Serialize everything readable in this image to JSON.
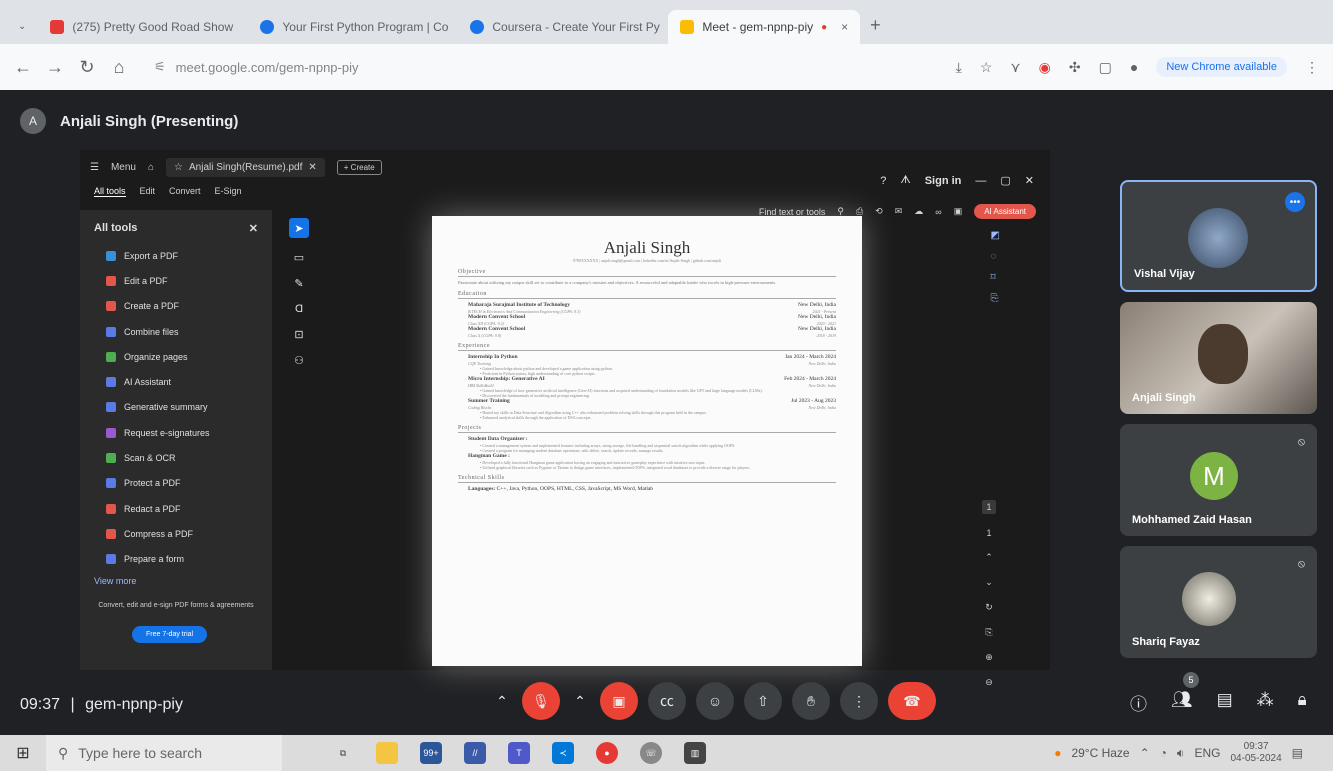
{
  "browser": {
    "tabs": [
      {
        "title": "(275) Pretty Good Road Show",
        "active": false,
        "favicon_color": "#e53935"
      },
      {
        "title": "Your First Python Program | Co",
        "active": false,
        "favicon_color": "#1a73e8"
      },
      {
        "title": "Coursera - Create Your First Py",
        "active": false,
        "favicon_color": "#1a73e8"
      },
      {
        "title": "Meet - gem-npnp-piy",
        "active": true,
        "favicon_color": "#fbbc04"
      }
    ],
    "tab_close": "×",
    "new_tab": "+",
    "url": "meet.google.com/gem-npnp-piy",
    "new_chrome_label": "New Chrome available"
  },
  "meet": {
    "presenter_initial": "A",
    "presenter_label": "Anjali Singh (Presenting)",
    "time": "09:37",
    "separator": "|",
    "meeting_code": "gem-npnp-piy",
    "participant_count": "5",
    "participants": [
      {
        "name": "Vishal Vijay",
        "active_speaker": true
      },
      {
        "name": "Anjali Singh"
      },
      {
        "name": "Mohhamed Zaid Hasan",
        "initial": "M"
      },
      {
        "name": "Shariq Fayaz"
      }
    ],
    "accent_color": "#8ab4f8",
    "end_call_color": "#ea4335"
  },
  "acrobat": {
    "menu_label": "Menu",
    "file_tab": "Anjali Singh(Resume).pdf",
    "create_label": "+ Create",
    "menu_tabs": [
      "All tools",
      "Edit",
      "Convert",
      "E-Sign"
    ],
    "sign_in": "Sign in",
    "find_text": "Find text or tools",
    "ai_assistant": "AI Assistant",
    "panel_title": "All tools",
    "tools": [
      {
        "label": "Export a PDF",
        "color": "#3a8fd9"
      },
      {
        "label": "Edit a PDF",
        "color": "#e3564b"
      },
      {
        "label": "Create a PDF",
        "color": "#e3564b"
      },
      {
        "label": "Combine files",
        "color": "#5a7be6"
      },
      {
        "label": "Organize pages",
        "color": "#4caf50"
      },
      {
        "label": "AI Assistant",
        "color": "#5a7be6"
      },
      {
        "label": "Generative summary",
        "color": "#5a7be6"
      },
      {
        "label": "Request e-signatures",
        "color": "#9b59d0"
      },
      {
        "label": "Scan & OCR",
        "color": "#4caf50"
      },
      {
        "label": "Protect a PDF",
        "color": "#5a7be6"
      },
      {
        "label": "Redact a PDF",
        "color": "#e3564b"
      },
      {
        "label": "Compress a PDF",
        "color": "#e3564b"
      },
      {
        "label": "Prepare a form",
        "color": "#5a7be6"
      }
    ],
    "view_more": "View more",
    "footer_text": "Convert, edit and e-sign PDF forms & agreements",
    "trial_button": "Free 7-day trial",
    "page_number": "1"
  },
  "resume": {
    "name": "Anjali Singh",
    "contact": "9789XXXXXX | anjali.singh@gmail.com | linkedin.com/in/Anjali-Singh | github.com/anjali",
    "objective_heading": "Objective",
    "objective": "Passionate about utilizing my unique skill set to contribute to a company's mission and objectives. A resourceful and adaptable leader who excels in high-pressure environments.",
    "education_heading": "Education",
    "education": [
      {
        "school": "Maharaja Surajmal Institute of Technology",
        "loc": "New Delhi, India",
        "detail": "B.TECH in Electronics And Communication Engineering (CGPA: 8.3)",
        "date": "2021 - Present"
      },
      {
        "school": "Modern Convent School",
        "loc": "New Delhi, India",
        "detail": "Class XII (CGPA: 9.2)",
        "date": "2020 - 2021"
      },
      {
        "school": "Modern Convent School",
        "loc": "New Delhi, India",
        "detail": "Class X (CGPA: 9.8)",
        "date": "2018 - 2019"
      }
    ],
    "experience_heading": "Experience",
    "experience": [
      {
        "title": "Internship In Python",
        "date": "Jan 2024 - March 2024",
        "org": "CQE Training",
        "loc": "New Delhi, India",
        "bullets": [
          "Gained knowledge about python and developed a game application using python.",
          "Proficient in Python syntax, high understanding of core python scripts."
        ]
      },
      {
        "title": "Micro Internship: Generative AI",
        "date": "Feb 2024 - March 2024",
        "org": "IBM SkillsBuild",
        "loc": "New Delhi, India",
        "bullets": [
          "Gained knowledge of how generative artificial intelligence (Gen-AI) functions and acquired understanding of foundation models like GPT and large language models (LLMs).",
          "Discovered the fundamentals of modeling and prompt engineering."
        ]
      },
      {
        "title": "Summer Training",
        "date": "Jul 2023 - Aug 2023",
        "org": "Coding Blocks",
        "loc": "New Delhi, India",
        "bullets": [
          "Honed my skills in Data Structure and Algorithm using C++ also exhausted problem solving skills through this program held in the campus.",
          "Enhanced analytical skills through the application of DSA concepts."
        ]
      }
    ],
    "projects_heading": "Projects",
    "projects": [
      {
        "title": "Student Data Organizer :",
        "bullets": [
          "Created a management system and implemented features including arrays, string storage, file handling and sequential search algorithm while applying OOPS.",
          "Created a program for managing student database operations: add, delete, search, update records, manage results."
        ]
      },
      {
        "title": "Hangman Game :",
        "bullets": [
          "Developed a fully functional Hangman game application having an engaging and interactive gameplay experience with intuitive user input.",
          "Utilized graphical libraries such as Pygame or Tkinter to design game interfaces, implemented OOPS, integrated word databases to provide a diverse range for players."
        ]
      }
    ],
    "skills_heading": "Technical Skills",
    "skills_label": "Languages:",
    "skills": "C++, Java, Python, OOPS, HTML, CSS, JavaScript, MS Word, Matlab"
  },
  "taskbar": {
    "search_placeholder": "Type here to search",
    "weather": "29°C Haze",
    "lang": "ENG",
    "time": "09:37",
    "date": "04-05-2024"
  }
}
